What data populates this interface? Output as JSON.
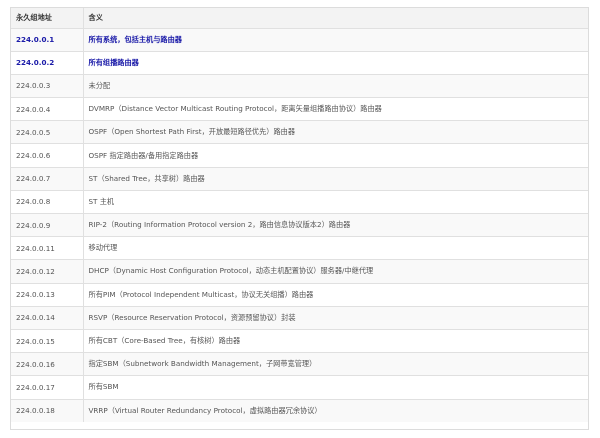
{
  "table": {
    "headers": [
      "永久组地址",
      "含义"
    ],
    "rows": [
      {
        "address": "224.0.0.1",
        "meaning": "所有系统，包括主机与路由器",
        "highlight": true
      },
      {
        "address": "224.0.0.2",
        "meaning": "所有组播路由器",
        "highlight": true
      },
      {
        "address": "224.0.0.3",
        "meaning": "未分配",
        "highlight": false
      },
      {
        "address": "224.0.0.4",
        "meaning": "DVMRP（Distance Vector Multicast Routing Protocol，距离矢量组播路由协议）路由器",
        "highlight": false
      },
      {
        "address": "224.0.0.5",
        "meaning": "OSPF（Open Shortest Path First，开放最短路径优先）路由器",
        "highlight": false
      },
      {
        "address": "224.0.0.6",
        "meaning": "OSPF 指定路由器/备用指定路由器",
        "highlight": false
      },
      {
        "address": "224.0.0.7",
        "meaning": "ST（Shared Tree，共享树）路由器",
        "highlight": false
      },
      {
        "address": "224.0.0.8",
        "meaning": "ST 主机",
        "highlight": false
      },
      {
        "address": "224.0.0.9",
        "meaning": "RIP-2（Routing Information Protocol version 2，路由信息协议版本2）路由器",
        "highlight": false
      },
      {
        "address": "224.0.0.11",
        "meaning": "移动代理",
        "highlight": false
      },
      {
        "address": "224.0.0.12",
        "meaning": "DHCP（Dynamic Host Configuration Protocol，动态主机配置协议）服务器/中继代理",
        "highlight": false
      },
      {
        "address": "224.0.0.13",
        "meaning": "所有PIM（Protocol Independent Multicast，协议无关组播）路由器",
        "highlight": false
      },
      {
        "address": "224.0.0.14",
        "meaning": "RSVP（Resource Reservation Protocol，资源预留协议）封装",
        "highlight": false
      },
      {
        "address": "224.0.0.15",
        "meaning": "所有CBT（Core-Based Tree，有核树）路由器",
        "highlight": false
      },
      {
        "address": "224.0.0.16",
        "meaning": "指定SBM（Subnetwork Bandwidth Management，子网带宽管理）",
        "highlight": false
      },
      {
        "address": "224.0.0.17",
        "meaning": "所有SBM",
        "highlight": false
      },
      {
        "address": "224.0.0.18",
        "meaning": "VRRP（Virtual Router Redundancy Protocol，虚拟路由器冗余协议）",
        "highlight": false
      }
    ]
  },
  "colors": {
    "highlight_text": "#1a1aa8",
    "normal_text": "#555555",
    "header_bg": "#f3f3f3",
    "border": "#e0e0e0"
  }
}
